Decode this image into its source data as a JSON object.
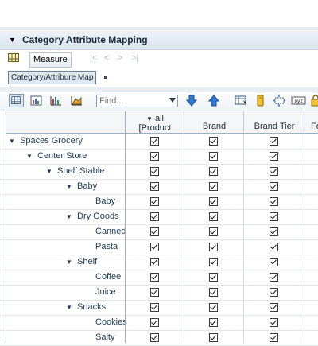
{
  "panel": {
    "title": "Category Attribute Mapping"
  },
  "toolbar1": {
    "measure_label": "Measure",
    "nav": [
      "|<",
      "<",
      ">",
      ">|"
    ]
  },
  "breadcrumb": {
    "label": "Category/Attribure Map"
  },
  "find": {
    "placeholder": "Find...",
    "value": "Find..."
  },
  "columns": [
    {
      "line1": "all",
      "line2": "[Product"
    },
    {
      "line1": "Brand",
      "line2": ""
    },
    {
      "line1": "Brand Tier",
      "line2": ""
    },
    {
      "line1": "Fo",
      "line2": ""
    }
  ],
  "rows": [
    {
      "label": "Spaces Grocery",
      "expanded": true,
      "checks": [
        true,
        true,
        true
      ]
    },
    {
      "label": "Center Store",
      "expanded": true,
      "checks": [
        true,
        true,
        true
      ]
    },
    {
      "label": "Shelf Stable",
      "expanded": true,
      "checks": [
        true,
        true,
        true
      ]
    },
    {
      "label": "Baby",
      "expanded": true,
      "checks": [
        true,
        true,
        true
      ]
    },
    {
      "label": "Baby",
      "expanded": null,
      "checks": [
        true,
        true,
        true
      ]
    },
    {
      "label": "Dry Goods",
      "expanded": true,
      "checks": [
        true,
        true,
        true
      ]
    },
    {
      "label": "Canned",
      "expanded": null,
      "checks": [
        true,
        true,
        true
      ]
    },
    {
      "label": "Pasta",
      "expanded": null,
      "checks": [
        true,
        true,
        true
      ]
    },
    {
      "label": "Shelf",
      "expanded": true,
      "checks": [
        true,
        true,
        true
      ]
    },
    {
      "label": "Coffee",
      "expanded": null,
      "checks": [
        true,
        true,
        true
      ]
    },
    {
      "label": "Juice",
      "expanded": null,
      "checks": [
        true,
        true,
        true
      ]
    },
    {
      "label": "Snacks",
      "expanded": true,
      "checks": [
        true,
        true,
        true
      ]
    },
    {
      "label": "Cookies",
      "expanded": null,
      "checks": [
        true,
        true,
        true
      ]
    },
    {
      "label": "Salty",
      "expanded": null,
      "checks": [
        true,
        true,
        true
      ]
    }
  ],
  "icons": [
    "grid-icon",
    "table-view-icon",
    "chart-view-icon",
    "bar-chart-icon",
    "area-chart-icon",
    "find-next-icon",
    "find-previous-icon",
    "column-settings-icon",
    "tag-icon",
    "pivot-icon",
    "xyz-icon",
    "lock-icon"
  ]
}
